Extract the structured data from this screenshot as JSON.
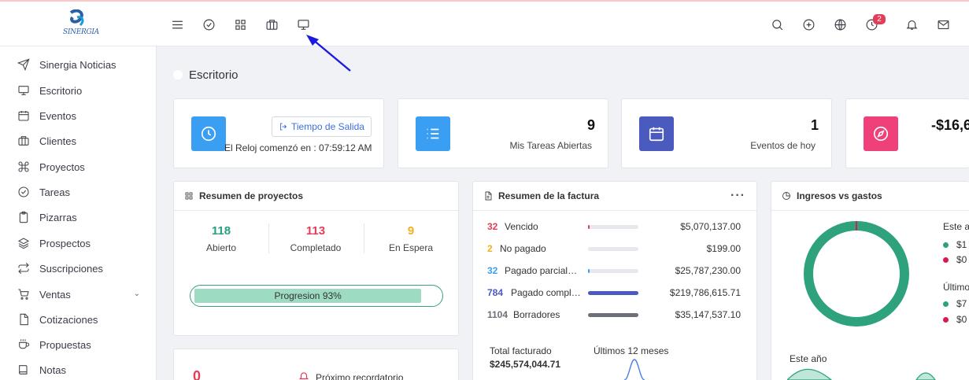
{
  "app": {
    "logo_text": "SINERGIA"
  },
  "topbar": {
    "left_icons": [
      "menu-icon",
      "check-circle-icon",
      "grid-icon",
      "briefcase-icon",
      "monitor-icon"
    ],
    "right_icons": [
      "search-icon",
      "plus-circle-icon",
      "globe-icon",
      "clock-icon",
      "bell-icon",
      "mail-icon"
    ],
    "clock_badge": "2"
  },
  "sidebar": {
    "items": [
      {
        "label": "Sinergia Noticias",
        "icon": "send-icon"
      },
      {
        "label": "Escritorio",
        "icon": "monitor-icon"
      },
      {
        "label": "Eventos",
        "icon": "calendar-icon"
      },
      {
        "label": "Clientes",
        "icon": "briefcase-icon"
      },
      {
        "label": "Proyectos",
        "icon": "command-icon"
      },
      {
        "label": "Tareas",
        "icon": "check-circle-icon"
      },
      {
        "label": "Pizarras",
        "icon": "clipboard-icon"
      },
      {
        "label": "Prospectos",
        "icon": "layers-icon"
      },
      {
        "label": "Suscripciones",
        "icon": "repeat-icon"
      },
      {
        "label": "Ventas",
        "icon": "cart-icon"
      },
      {
        "label": "Cotizaciones",
        "icon": "file-icon"
      },
      {
        "label": "Propuestas",
        "icon": "coffee-icon"
      },
      {
        "label": "Notas",
        "icon": "book-icon"
      }
    ]
  },
  "page": {
    "title": "Escritorio"
  },
  "clock_card": {
    "button": "Tiempo de Salida",
    "text": "El Reloj comenzó en : 07:59:12 AM"
  },
  "stats": [
    {
      "value": "9",
      "label": "Mis Tareas Abiertas",
      "color": "#3a9ff3"
    },
    {
      "value": "1",
      "label": "Eventos de hoy",
      "color": "#4a5abf"
    },
    {
      "value": "-$16,6",
      "label": "",
      "color": "#f0407a"
    }
  ],
  "projects": {
    "title": "Resumen de proyectos",
    "items": [
      {
        "value": "118",
        "label": "Abierto",
        "color": "#27a082"
      },
      {
        "value": "113",
        "label": "Completado",
        "color": "#e43d58"
      },
      {
        "value": "9",
        "label": "En Espera",
        "color": "#f3b019"
      }
    ],
    "progress_label": "Progresion 93%",
    "progress": 0.93
  },
  "invoices": {
    "title": "Resumen de la factura",
    "rows": [
      {
        "count": "32",
        "label": "Vencido",
        "amount": "$5,070,137.00",
        "color": "#e43d58",
        "fill": 0.02
      },
      {
        "count": "2",
        "label": "No pagado",
        "amount": "$199.00",
        "color": "#f3b019",
        "fill": 0.0
      },
      {
        "count": "32",
        "label": "Pagado parcialme...",
        "amount": "$25,787,230.00",
        "color": "#3a9ff3",
        "fill": 0.02
      },
      {
        "count": "784",
        "label": "Pagado complet...",
        "amount": "$219,786,615.71",
        "color": "#4a5abf",
        "fill": 1.0
      },
      {
        "count": "1104",
        "label": "Borradores",
        "amount": "$35,147,537.10",
        "color": "#6c7079",
        "fill": 1.0
      }
    ],
    "total_label": "Total facturado",
    "total_value": "$245,574,044.71",
    "last12": "Últimos 12 meses"
  },
  "income": {
    "title": "Ingresos vs gastos",
    "legend_year": "Este a",
    "legend_year_items": [
      "$1",
      "$0"
    ],
    "legend_last": "Último",
    "legend_last_items": [
      "$7",
      "$0"
    ],
    "este_ano": "Este año",
    "income_color": "#2ea27d",
    "expense_color": "#d81b4f"
  },
  "reminder": {
    "count": "0",
    "label": "Próximo recordatorio"
  }
}
